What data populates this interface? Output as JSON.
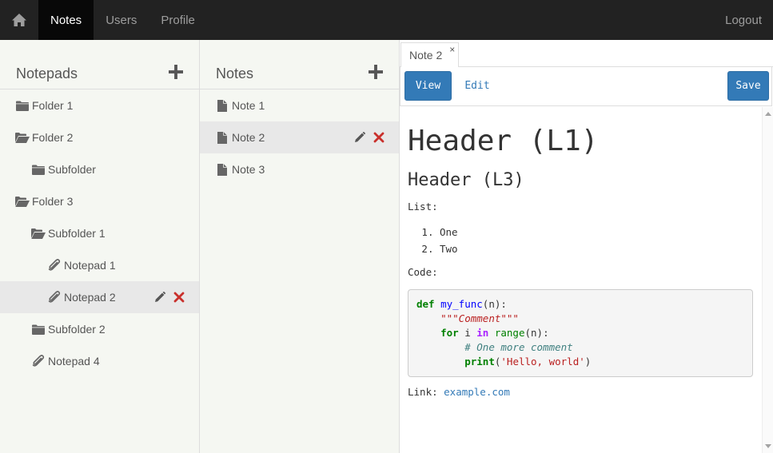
{
  "navbar": {
    "home_icon": "home-icon",
    "items": [
      {
        "label": "Notes"
      },
      {
        "label": "Users"
      },
      {
        "label": "Profile"
      }
    ],
    "logout_label": "Logout"
  },
  "notepads": {
    "title": "Notepads",
    "items": [
      {
        "label": "Folder 1",
        "icon": "folder-closed-icon"
      },
      {
        "label": "Folder 2",
        "icon": "folder-open-icon"
      },
      {
        "label": "Subfolder",
        "icon": "folder-closed-icon"
      },
      {
        "label": "Folder 3",
        "icon": "folder-open-icon"
      },
      {
        "label": "Subfolder 1",
        "icon": "folder-open-icon"
      },
      {
        "label": "Notepad 1",
        "icon": "paperclip-icon"
      },
      {
        "label": "Notepad 2",
        "icon": "paperclip-icon"
      },
      {
        "label": "Subfolder 2",
        "icon": "folder-closed-icon"
      },
      {
        "label": "Notepad 4",
        "icon": "paperclip-icon"
      }
    ]
  },
  "notes": {
    "title": "Notes",
    "items": [
      {
        "label": "Note 1",
        "icon": "file-icon"
      },
      {
        "label": "Note 2",
        "icon": "file-icon"
      },
      {
        "label": "Note 3",
        "icon": "file-icon"
      }
    ]
  },
  "editor": {
    "tab_label": "Note 2",
    "tab_close": "×",
    "view_label": "View",
    "edit_label": "Edit",
    "save_label": "Save",
    "content": {
      "h1": "Header (L1)",
      "h3": "Header (L3)",
      "list_label": "List:",
      "list_items": [
        "One",
        "Two"
      ],
      "code_label": "Code:",
      "code": {
        "l1_kw": "def",
        "l1_fn": "my_func",
        "l1_rest": "(n):",
        "l2_doc": "\"\"\"Comment\"\"\"",
        "l3_kw": "for",
        "l3_var": " i ",
        "l3_in": "in",
        "l3_sp": " ",
        "l3_range": "range",
        "l3_rest": "(n):",
        "l4_comment": "# One more comment",
        "l5_print": "print",
        "l5_open": "(",
        "l5_str": "'Hello, world'",
        "l5_close": ")"
      },
      "link_label": "Link: ",
      "link_text": "example.com"
    }
  },
  "colors": {
    "navbar_bg": "#222222",
    "navbar_active": "#080808",
    "primary": "#337ab7",
    "delete": "#c9302c",
    "sidebar_bg": "#f5f7f2"
  }
}
